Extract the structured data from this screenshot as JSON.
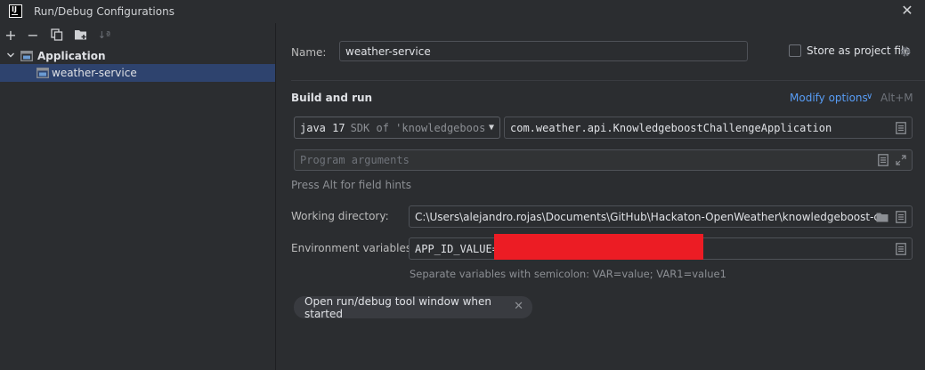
{
  "window": {
    "title": "Run/Debug Configurations",
    "logo_text": "IJ",
    "close_symbol": "✕"
  },
  "toolbar": {
    "add_symbol": "+",
    "remove_symbol": "−",
    "sort_symbol": "↓ª"
  },
  "tree": {
    "group_label": "Application",
    "selected_item": "weather-service"
  },
  "form": {
    "name_label": "Name:",
    "name_value": "weather-service",
    "store_label": "Store as project file",
    "build_heading": "Build and run",
    "modify_options": "Modify options",
    "modify_caret": "∨",
    "shortcut": "Alt+M",
    "jdk_main": "java 17",
    "jdk_sub": "SDK of 'knowledgeboos",
    "jdk_caret": "▼",
    "main_class": "com.weather.api.KnowledgeboostChallengeApplication",
    "program_args_placeholder": "Program arguments",
    "field_hint": "Press Alt for field hints",
    "workdir_label": "Working directory:",
    "workdir_value": "C:\\Users\\alejandro.rojas\\Documents\\GitHub\\Hackaton-OpenWeather\\knowledgeboost-challeng",
    "env_label": "Environment variables:",
    "env_value": "APP_ID_VALUE=",
    "env_hint": "Separate variables with semicolon: VAR=value; VAR1=value1",
    "tool_window_chip": "Open run/debug tool window when started",
    "chip_close": "✕"
  },
  "colors": {
    "background": "#2b2d30",
    "selection": "#2e436e",
    "link": "#589df6",
    "redaction": "#ec1c24"
  }
}
